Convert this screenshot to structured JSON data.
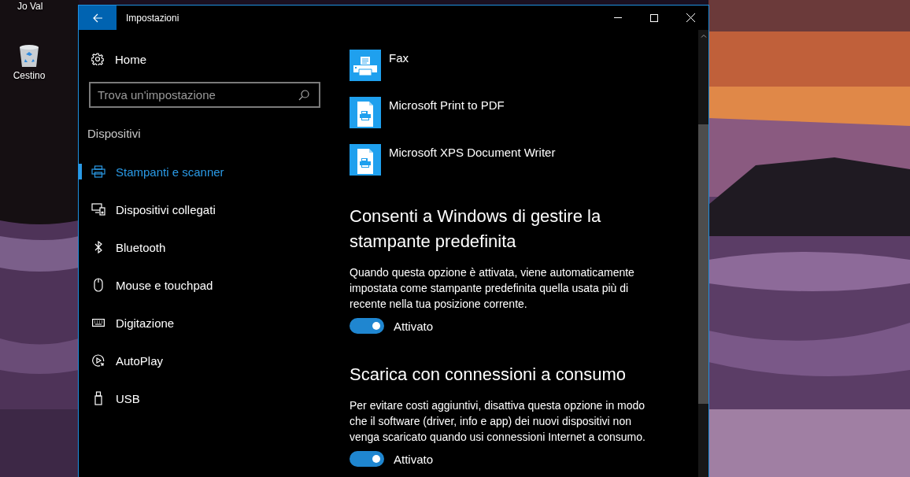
{
  "desktop": {
    "user_label": "Jo Val",
    "icons": [
      {
        "label": "Cestino",
        "kind": "recycle-bin"
      }
    ]
  },
  "window": {
    "title": "Impostazioni",
    "sidebar": {
      "home": "Home",
      "search": {
        "placeholder": "Trova un'impostazione"
      },
      "section": "Dispositivi",
      "items": [
        {
          "label": "Stampanti e scanner",
          "kind": "printer",
          "selected": true
        },
        {
          "label": "Dispositivi collegati",
          "kind": "devices",
          "selected": false
        },
        {
          "label": "Bluetooth",
          "kind": "bluetooth",
          "selected": false
        },
        {
          "label": "Mouse e touchpad",
          "kind": "mouse",
          "selected": false
        },
        {
          "label": "Digitazione",
          "kind": "keyboard",
          "selected": false
        },
        {
          "label": "AutoPlay",
          "kind": "autoplay",
          "selected": false
        },
        {
          "label": "USB",
          "kind": "usb",
          "selected": false
        }
      ]
    },
    "printers": [
      {
        "name": "Fax",
        "kind": "fax"
      },
      {
        "name": "Microsoft Print to PDF",
        "kind": "document"
      },
      {
        "name": "Microsoft XPS Document Writer",
        "kind": "document"
      }
    ],
    "settings": [
      {
        "heading": "Consenti a Windows di gestire la stampante predefinita",
        "description": "Quando questa opzione è attivata, viene automaticamente impostata come stampante predefinita quella usata più di recente nella tua posizione corrente.",
        "toggle": {
          "on": true,
          "label": "Attivato"
        }
      },
      {
        "heading": "Scarica con connessioni a consumo",
        "description": "Per evitare costi aggiuntivi, disattiva questa opzione in modo che il software (driver, info e app) dei nuovi dispositivi non venga scaricato quando usi connessioni Internet a consumo.",
        "toggle": {
          "on": true,
          "label": "Attivato"
        }
      }
    ]
  }
}
